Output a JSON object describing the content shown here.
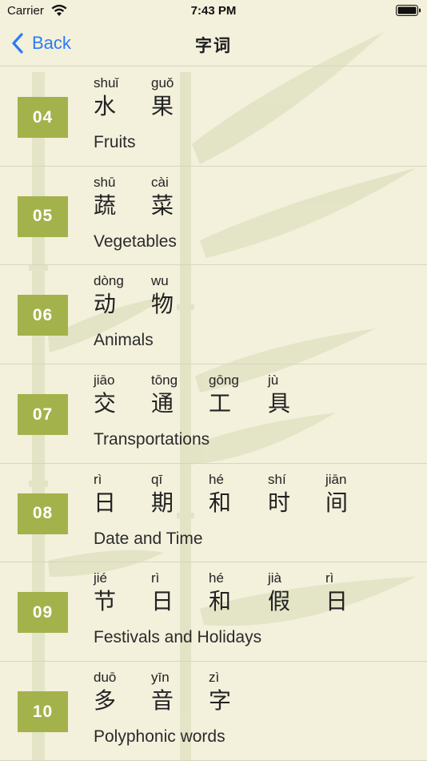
{
  "status_bar": {
    "carrier": "Carrier",
    "time": "7:43 PM"
  },
  "nav": {
    "back_label": "Back",
    "title": "字词"
  },
  "topics": [
    {
      "number": "04",
      "label": "Fruits",
      "chars": [
        {
          "pinyin": "shuǐ",
          "hanzi": "水"
        },
        {
          "pinyin": "guǒ",
          "hanzi": "果"
        }
      ]
    },
    {
      "number": "05",
      "label": "Vegetables",
      "chars": [
        {
          "pinyin": "shū",
          "hanzi": "蔬"
        },
        {
          "pinyin": "cài",
          "hanzi": "菜"
        }
      ]
    },
    {
      "number": "06",
      "label": "Animals",
      "chars": [
        {
          "pinyin": "dòng",
          "hanzi": "动"
        },
        {
          "pinyin": "wu",
          "hanzi": "物"
        }
      ]
    },
    {
      "number": "07",
      "label": "Transportations",
      "chars": [
        {
          "pinyin": "jiāo",
          "hanzi": "交"
        },
        {
          "pinyin": "tōng",
          "hanzi": "通"
        },
        {
          "pinyin": "gōng",
          "hanzi": "工"
        },
        {
          "pinyin": "jù",
          "hanzi": "具"
        }
      ]
    },
    {
      "number": "08",
      "label": "Date and Time",
      "chars": [
        {
          "pinyin": "rì",
          "hanzi": "日"
        },
        {
          "pinyin": "qī",
          "hanzi": "期"
        },
        {
          "pinyin": "hé",
          "hanzi": "和"
        },
        {
          "pinyin": "shí",
          "hanzi": "时"
        },
        {
          "pinyin": "jiān",
          "hanzi": "间"
        }
      ]
    },
    {
      "number": "09",
      "label": "Festivals and Holidays",
      "chars": [
        {
          "pinyin": "jié",
          "hanzi": "节"
        },
        {
          "pinyin": "rì",
          "hanzi": "日"
        },
        {
          "pinyin": "hé",
          "hanzi": "和"
        },
        {
          "pinyin": "jià",
          "hanzi": "假"
        },
        {
          "pinyin": "rì",
          "hanzi": "日"
        }
      ]
    },
    {
      "number": "10",
      "label": "Polyphonic words",
      "chars": [
        {
          "pinyin": "duō",
          "hanzi": "多"
        },
        {
          "pinyin": "yīn",
          "hanzi": "音"
        },
        {
          "pinyin": "zì",
          "hanzi": "字"
        }
      ]
    }
  ],
  "icons": {
    "back": "chevron-left-icon",
    "wifi": "wifi-icon",
    "battery": "battery-icon",
    "background": "bamboo-watermark"
  },
  "colors": {
    "accent": "#2a7cf6",
    "badge": "#a3b24b",
    "background": "#f3f0dc"
  }
}
